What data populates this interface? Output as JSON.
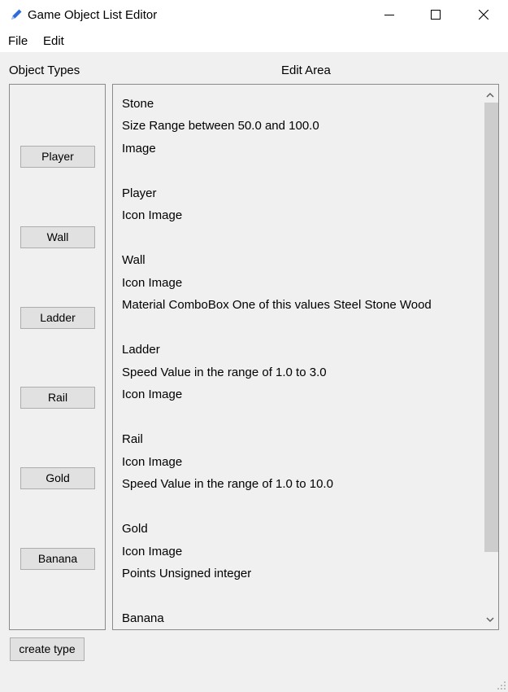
{
  "window": {
    "title": "Game Object List Editor",
    "app_icon": "pencil-icon"
  },
  "menu": [
    "File",
    "Edit"
  ],
  "labels": {
    "object_types": "Object Types",
    "edit_area": "Edit Area"
  },
  "object_types": [
    "Player",
    "Wall",
    "Ladder",
    "Rail",
    "Gold",
    "Banana"
  ],
  "edit_lines": [
    "Stone",
    "Size Range between 50.0 and 100.0",
    "Image",
    "Player",
    "Icon Image",
    "Wall",
    "Icon Image",
    "Material ComboBox One of this values Steel Stone Wood",
    "Ladder",
    "Speed Value in the range of 1.0 to 3.0",
    "Icon Image",
    "Rail",
    "Icon Image",
    "Speed Value in the range of 1.0 to 10.0",
    "Gold",
    "Icon Image",
    "Points Unsigned integer",
    "Banana"
  ],
  "buttons": {
    "create_type": "create type"
  },
  "colors": {
    "window_bg": "#f0f0f0",
    "button_bg": "#e1e1e1",
    "button_border": "#adadad",
    "scroll_thumb": "#cdcdcd",
    "pencil_blue": "#2e6bd8"
  }
}
